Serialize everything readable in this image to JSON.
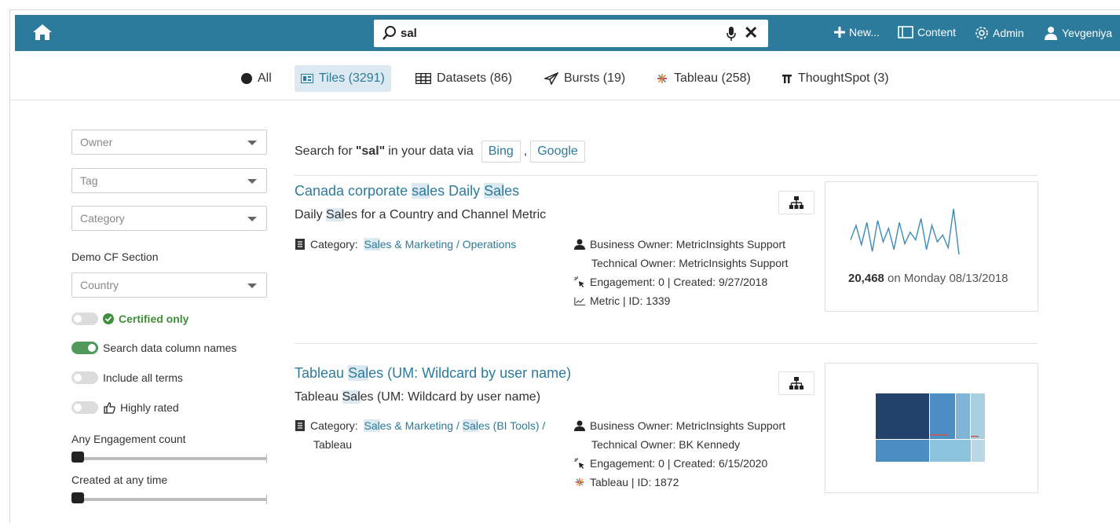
{
  "topbar": {
    "search_value": "sal",
    "new_label": "New...",
    "content_label": "Content",
    "admin_label": "Admin",
    "user_label": "Yevgeniya",
    "color": "#2c7b9c"
  },
  "tabs": [
    {
      "label": "All"
    },
    {
      "label": "Tiles (3291)"
    },
    {
      "label": "Datasets (86)"
    },
    {
      "label": "Bursts (19)"
    },
    {
      "label": "Tableau (258)"
    },
    {
      "label": "ThoughtSpot (3)"
    }
  ],
  "sidebar": {
    "owner": "Owner",
    "tag": "Tag",
    "category": "Category",
    "section": "Demo CF Section",
    "country": "Country",
    "certified": "Certified only",
    "search_columns": "Search data column names",
    "include_terms": "Include all terms",
    "highly_rated": "Highly rated",
    "engagement": "Any Engagement count",
    "created": "Created at any time"
  },
  "main": {
    "searchfor_prefix": "Search for ",
    "searchfor_term": "\"sal\"",
    "searchfor_suffix": " in your data via",
    "bing": "Bing",
    "comma": ",",
    "google": "Google"
  },
  "results": [
    {
      "title_parts": [
        "Canada corporate ",
        "sal",
        "es Daily ",
        "Sal",
        "es"
      ],
      "sub_parts": [
        "Daily ",
        "Sal",
        "es for a Country and Channel Metric"
      ],
      "category_label": "Category:",
      "category_parts": [
        "Sal",
        "es & Marketing / Operations"
      ],
      "business_owner": "Business Owner: MetricInsights Support",
      "technical_owner": "Technical Owner: MetricInsights Support",
      "engagement": "Engagement: 0 | Created: 9/27/2018",
      "type": "Metric  |  ID: 1339",
      "metric_value": "20,468",
      "metric_date": " on Monday 08/13/2018",
      "sparkline": [
        40,
        55,
        35,
        58,
        28,
        60,
        38,
        52,
        30,
        58,
        36,
        48,
        40,
        62,
        30,
        55,
        38,
        45,
        32,
        72,
        25
      ]
    },
    {
      "title_parts": [
        "Tableau ",
        "Sal",
        "es (UM: Wildcard by user name)"
      ],
      "sub_parts": [
        "Tableau ",
        "Sal",
        "es (UM: Wildcard by user name)"
      ],
      "category_label": "Category:",
      "category_parts": [
        "Sal",
        "es & Marketing / ",
        "Sal",
        "es (BI Tools) /"
      ],
      "category_line2": "Tableau",
      "business_owner": "Business Owner: MetricInsights Support",
      "technical_owner": "Technical Owner: BK Kennedy",
      "engagement": "Engagement: 0 | Created: 6/15/2020",
      "type": "Tableau  |  ID: 1872"
    }
  ]
}
